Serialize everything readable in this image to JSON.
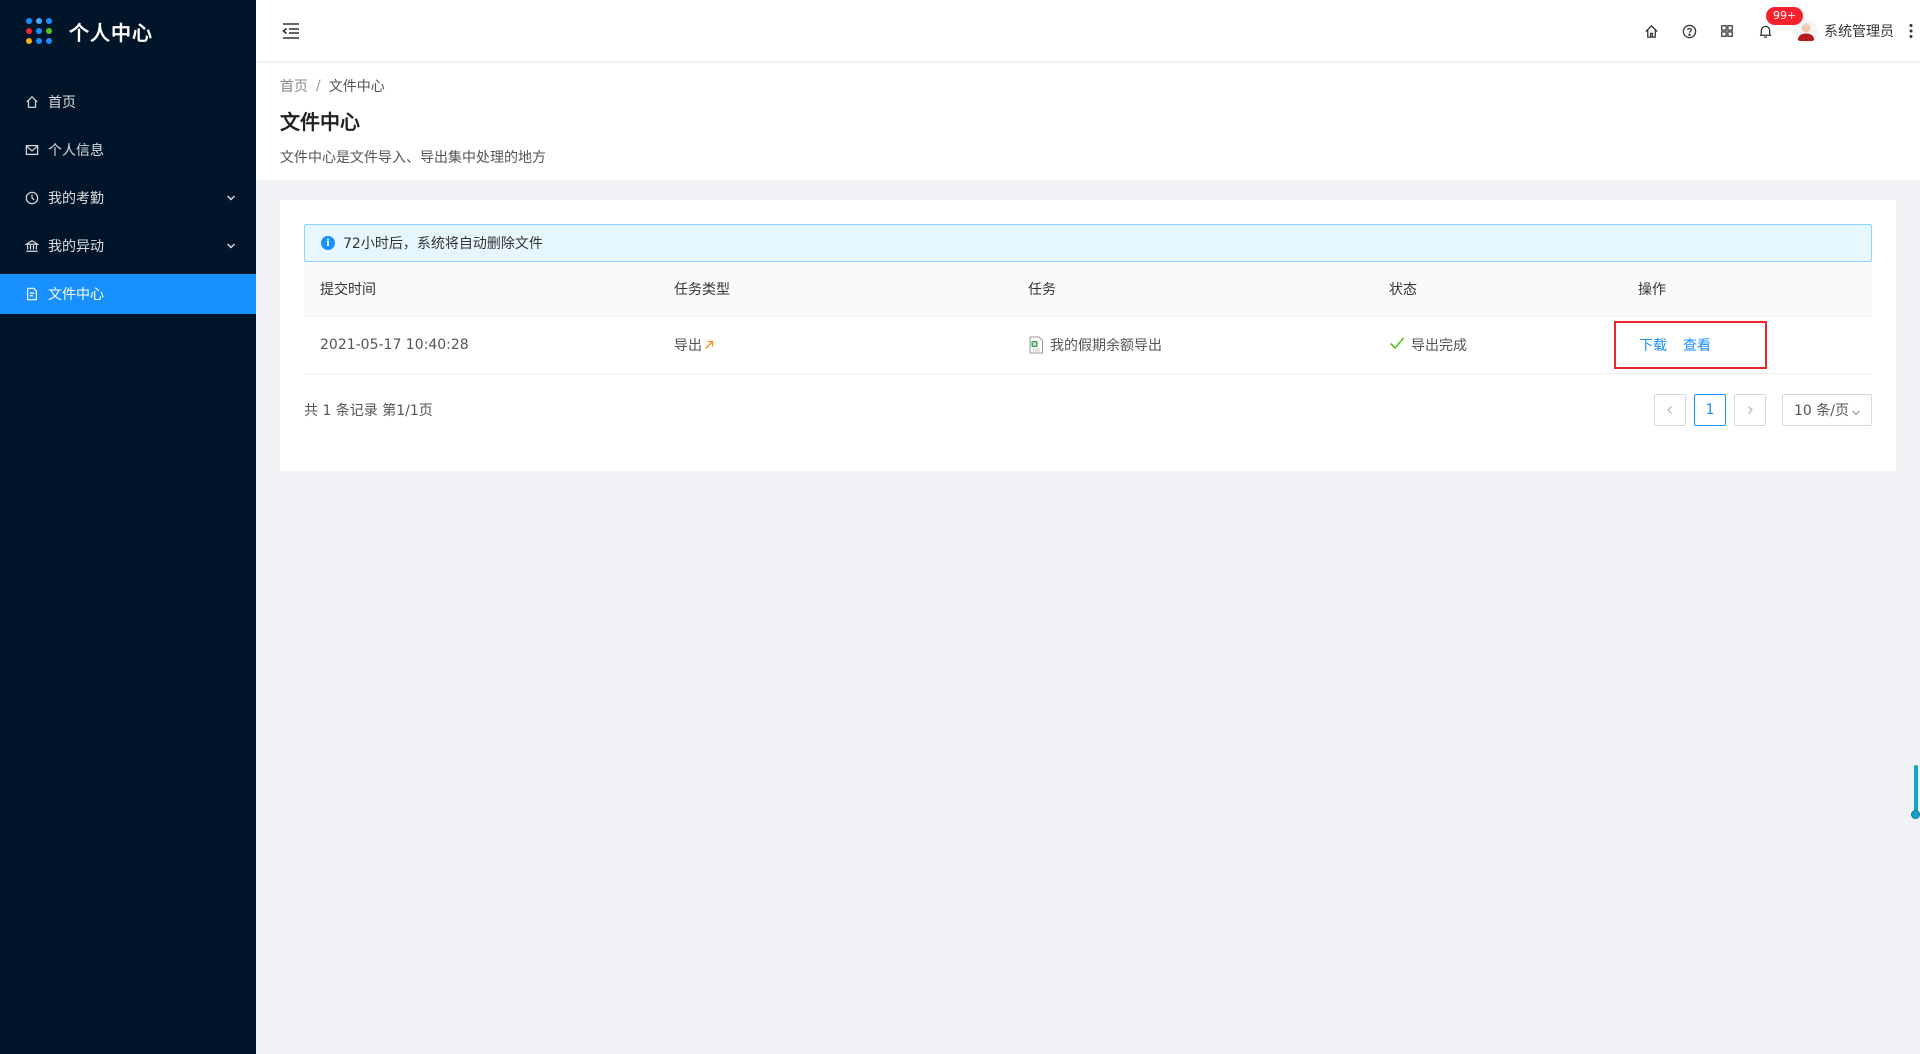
{
  "app": {
    "title": "个人中心"
  },
  "sidebar": {
    "items": [
      {
        "label": "首页",
        "icon": "home-icon"
      },
      {
        "label": "个人信息",
        "icon": "mail-icon"
      },
      {
        "label": "我的考勤",
        "icon": "clock-icon",
        "expandable": true
      },
      {
        "label": "我的异动",
        "icon": "bank-icon",
        "expandable": true
      },
      {
        "label": "文件中心",
        "icon": "file-icon",
        "active": true
      }
    ]
  },
  "header": {
    "notification_count": "99+",
    "user_name": "系统管理员"
  },
  "breadcrumb": {
    "home": "首页",
    "separator": "/",
    "current": "文件中心"
  },
  "page": {
    "title": "文件中心",
    "description": "文件中心是文件导入、导出集中处理的地方"
  },
  "alert": {
    "text": "72小时后，系统将自动删除文件"
  },
  "table": {
    "headers": [
      "提交时间",
      "任务类型",
      "任务",
      "状态",
      "操作"
    ],
    "rows": [
      {
        "submit_time": "2021-05-17 10:40:28",
        "task_type": "导出",
        "task": "我的假期余额导出",
        "status": "导出完成",
        "actions": [
          "下载",
          "查看"
        ]
      }
    ]
  },
  "pagination": {
    "total_text": "共 1 条记录 第1/1页",
    "current_page": "1",
    "page_size": "10 条/页"
  },
  "colors": {
    "sidebar_bg": "#001529",
    "accent": "#1890ff",
    "highlight_box": "#e8262d",
    "badge": "#f5222d",
    "success": "#52c41a"
  }
}
